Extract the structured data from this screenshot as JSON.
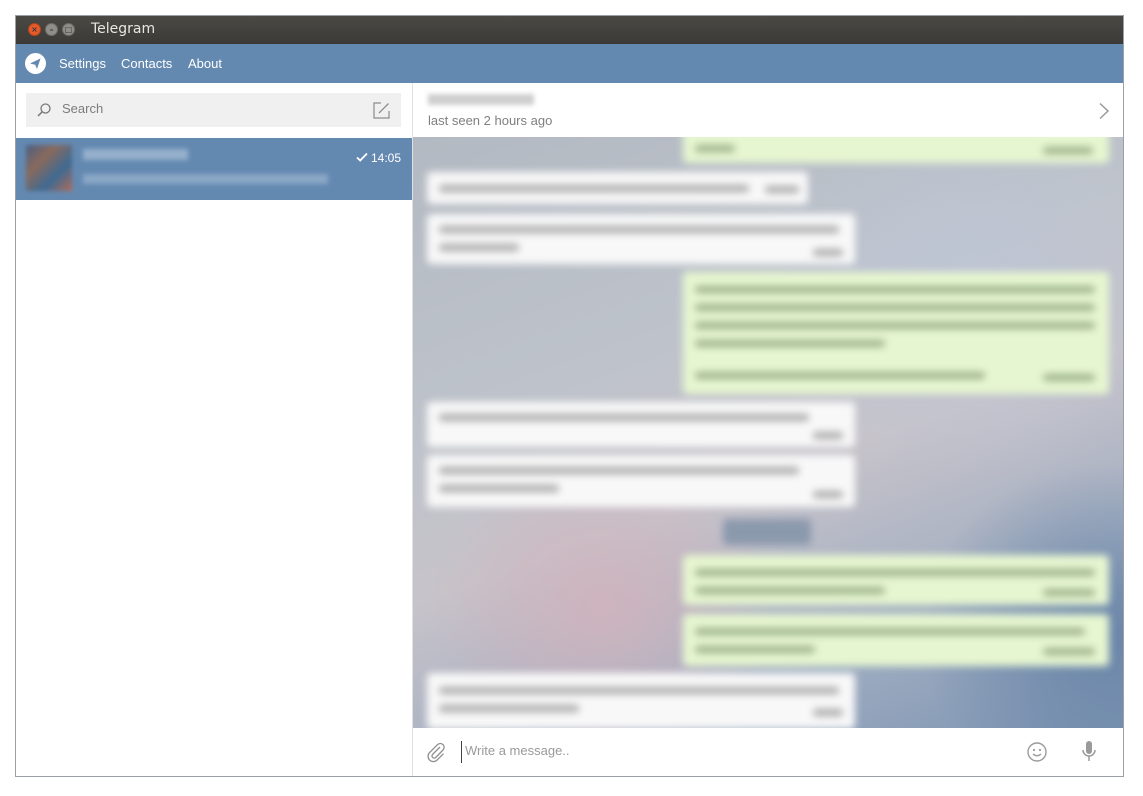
{
  "window": {
    "title": "Telegram"
  },
  "menu": {
    "items": [
      "Settings",
      "Contacts",
      "About"
    ]
  },
  "search": {
    "placeholder": "Search"
  },
  "dialogs": [
    {
      "time": "14:05",
      "read": true
    }
  ],
  "header": {
    "status": "last seen 2 hours ago"
  },
  "composer": {
    "placeholder": "Write a message.."
  },
  "colors": {
    "accent": "#6489b1",
    "titlebar": "#3e3d39",
    "outgoing_bubble": "#e6f6d0",
    "incoming_bubble": "#f8f8f8"
  }
}
